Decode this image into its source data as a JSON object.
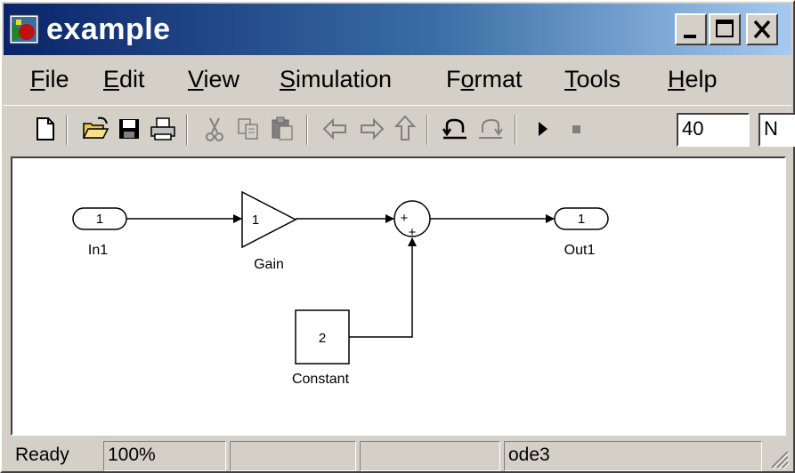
{
  "window": {
    "title": "example"
  },
  "menu": {
    "file": {
      "accel": "F",
      "rest": "ile"
    },
    "edit": {
      "accel": "E",
      "rest": "dit"
    },
    "view": {
      "accel": "V",
      "rest": "iew"
    },
    "simulation": {
      "accel": "S",
      "rest": "imulation"
    },
    "format": {
      "pre": "F",
      "accel": "o",
      "rest": "rmat"
    },
    "tools": {
      "accel": "T",
      "rest": "ools"
    },
    "help": {
      "accel": "H",
      "rest": "elp"
    }
  },
  "toolbar": {
    "icons": [
      "new-icon",
      "open-icon",
      "save-icon",
      "print-icon",
      "cut-icon",
      "copy-icon",
      "paste-icon",
      "back-icon",
      "forward-icon",
      "up-icon",
      "undo-icon",
      "redo-icon",
      "start-simulation-icon",
      "stop-simulation-icon"
    ],
    "stop_time": "40",
    "sim_mode_partial": "N"
  },
  "diagram": {
    "in1": {
      "port": "1",
      "label": "In1"
    },
    "gain": {
      "value": "1",
      "label": "Gain"
    },
    "sum": {
      "sign1": "+",
      "sign2": "+"
    },
    "constant": {
      "value": "2",
      "label": "Constant"
    },
    "out1": {
      "port": "1",
      "label": "Out1"
    }
  },
  "status": {
    "state": "Ready",
    "zoom": "100%",
    "pane3": "",
    "pane4": "",
    "solver": "ode3"
  }
}
